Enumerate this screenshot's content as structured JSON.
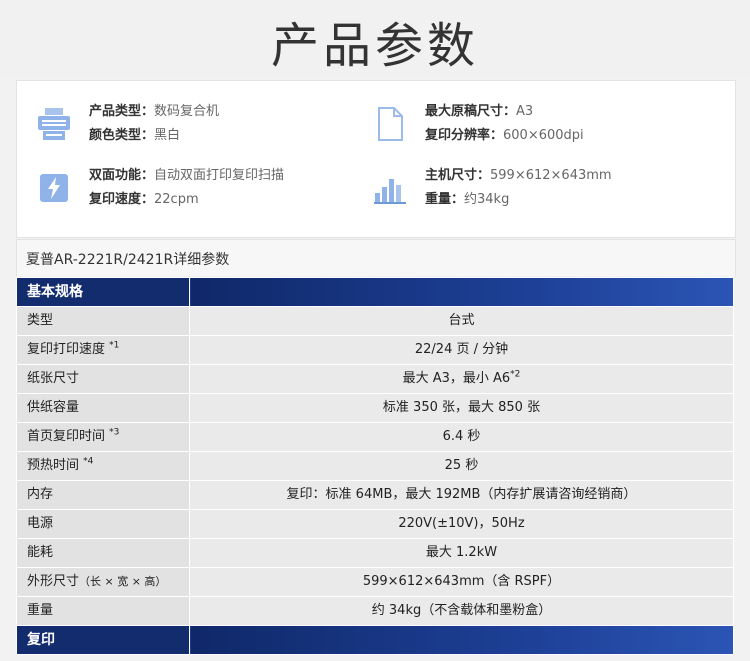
{
  "page": {
    "title": "产品参数"
  },
  "summary": {
    "product_type": {
      "label": "产品类型：",
      "value": "数码复合机"
    },
    "color_type": {
      "label": "颜色类型：",
      "value": "黑白"
    },
    "duplex": {
      "label": "双面功能：",
      "value": "自动双面打印复印扫描"
    },
    "copy_speed": {
      "label": "复印速度：",
      "value": "22cpm"
    },
    "max_original": {
      "label": "最大原稿尺寸：",
      "value": "A3"
    },
    "resolution": {
      "label": "复印分辨率：",
      "value": "600×600dpi"
    },
    "main_size": {
      "label": "主机尺寸：",
      "value": "599×612×643mm"
    },
    "weight": {
      "label": "重量：",
      "value": "约34kg"
    }
  },
  "model_header": "夏普AR-2221R/2421R详细参数",
  "sections": {
    "basic": "基本规格",
    "copy": "复印"
  },
  "rows": [
    {
      "label": "类型",
      "value": "台式"
    },
    {
      "label": "复印打印速度",
      "sup": "*1",
      "value": "22/24 页 / 分钟"
    },
    {
      "label": "纸张尺寸",
      "value": "最大 A3，最小 A6",
      "value_sup": "*2"
    },
    {
      "label": "供纸容量",
      "value": "标准 350 张，最大 850 张"
    },
    {
      "label": "首页复印时间",
      "sup": "*3",
      "value": "6.4 秒"
    },
    {
      "label": "预热时间",
      "sup": "*4",
      "value": "25 秒"
    },
    {
      "label": "内存",
      "value": "复印：标准 64MB，最大 192MB（内存扩展请咨询经销商）"
    },
    {
      "label": "电源",
      "value": "220V(±10V)，50Hz"
    },
    {
      "label": "能耗",
      "value": "最大 1.2kW"
    },
    {
      "label": "外形尺寸",
      "label_note": "（长 × 宽 × 高）",
      "value": "599×612×643mm（含 RSPF）"
    },
    {
      "label": "重量",
      "value": "约 34kg（不含载体和墨粉盒）"
    }
  ],
  "colors": {
    "section_bg": "#17327a",
    "icon_blue": "#8fb3e8",
    "label_bg": "#e2e2e2",
    "value_bg": "#eaeaea"
  },
  "icons": [
    "printer-icon",
    "document-icon",
    "lightning-icon",
    "bar-chart-icon"
  ]
}
